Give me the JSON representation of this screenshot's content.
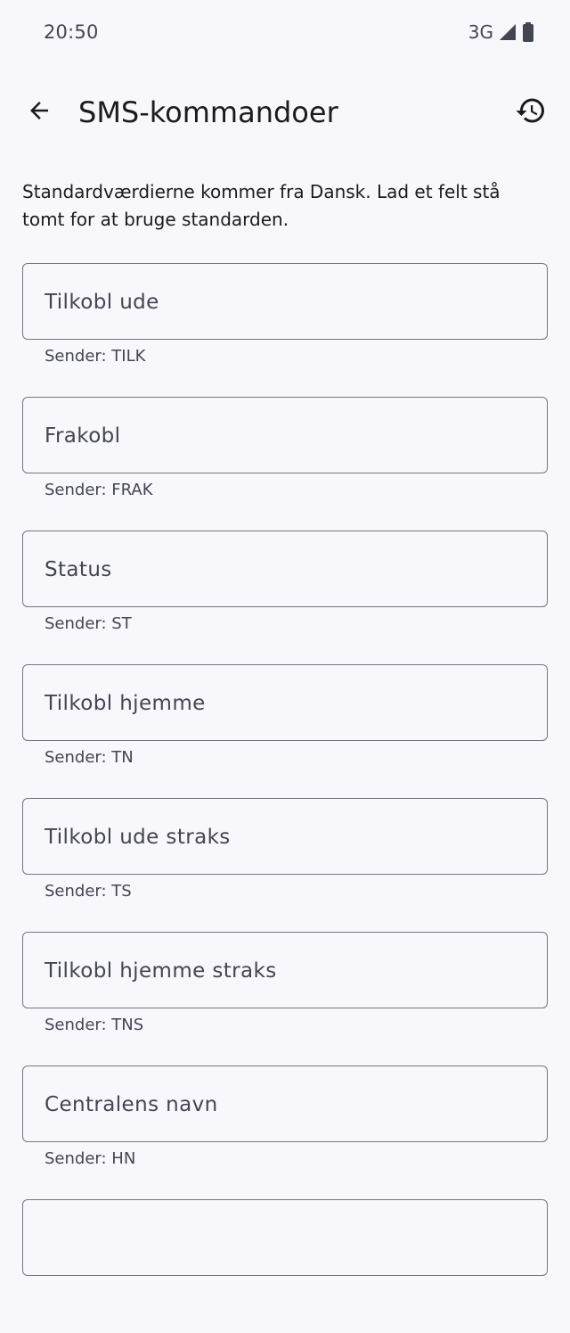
{
  "status_bar": {
    "time": "20:50",
    "network": "3G",
    "icons": [
      "signal-icon",
      "battery-icon"
    ]
  },
  "app_bar": {
    "title": "SMS-kommandoer",
    "back_icon": "arrow-back-icon",
    "history_icon": "history-icon"
  },
  "description": "Standardværdierne kommer fra Dansk. Lad et felt stå tomt for at bruge standarden.",
  "fields": [
    {
      "label": "Tilkobl ude",
      "helper": "Sender: TILK"
    },
    {
      "label": "Frakobl",
      "helper": "Sender: FRAK"
    },
    {
      "label": "Status",
      "helper": "Sender: ST"
    },
    {
      "label": "Tilkobl hjemme",
      "helper": "Sender: TN"
    },
    {
      "label": "Tilkobl ude straks",
      "helper": "Sender: TS"
    },
    {
      "label": "Tilkobl hjemme straks",
      "helper": "Sender: TNS"
    },
    {
      "label": "Centralens navn",
      "helper": "Sender: HN"
    },
    {
      "label": "",
      "helper": ""
    }
  ],
  "colors": {
    "background": "#f8f7fc",
    "outline": "#74777f",
    "on_surface": "#1b1b1f",
    "on_surface_variant": "#44464f"
  }
}
